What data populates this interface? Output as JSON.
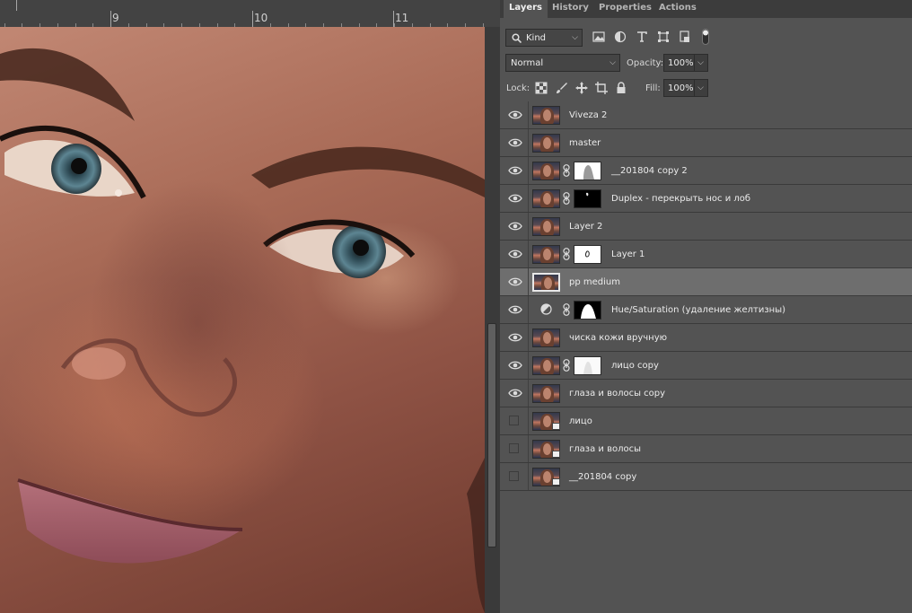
{
  "ruler": {
    "labels": [
      "9",
      "10",
      "11"
    ]
  },
  "panel": {
    "tabs": [
      {
        "label": "Layers",
        "active": true
      },
      {
        "label": "History",
        "active": false
      },
      {
        "label": "Properties",
        "active": false
      },
      {
        "label": "Actions",
        "active": false
      }
    ],
    "filter": {
      "kind_label": "Kind",
      "icons": [
        "pixel-filter-icon",
        "adjustment-filter-icon",
        "type-filter-icon",
        "shape-filter-icon",
        "smart-object-filter-icon",
        "filter-toggle-icon"
      ]
    },
    "blend": {
      "mode": "Normal",
      "opacity_label": "Opacity:",
      "opacity_value": "100%"
    },
    "lock": {
      "label": "Lock:",
      "fill_label": "Fill:",
      "fill_value": "100%",
      "icons": [
        "lock-transparent-icon",
        "lock-paint-icon",
        "lock-move-icon",
        "lock-artboard-icon",
        "lock-all-icon"
      ]
    }
  },
  "layers": [
    {
      "name": "Viveza 2",
      "visible": true,
      "type": "pixel"
    },
    {
      "name": "master",
      "visible": true,
      "type": "pixel"
    },
    {
      "name": "__201804 copy 2",
      "visible": true,
      "type": "masked",
      "mask": "silhouette"
    },
    {
      "name": "Duplex - перекрыть нос и лоб",
      "visible": true,
      "type": "masked",
      "mask": "black-small"
    },
    {
      "name": "Layer 2",
      "visible": true,
      "type": "pixel"
    },
    {
      "name": "Layer 1",
      "visible": true,
      "type": "masked",
      "mask": "white-small"
    },
    {
      "name": "pp medium",
      "visible": true,
      "type": "pixel",
      "selected": true
    },
    {
      "name": "Hue/Saturation  (удаление желтизны)",
      "visible": true,
      "type": "adjustment",
      "mask": "black-silhouette"
    },
    {
      "name": "чиска кожи вручную",
      "visible": true,
      "type": "pixel"
    },
    {
      "name": "лицо  copy",
      "visible": true,
      "type": "masked",
      "mask": "white-faint"
    },
    {
      "name": "глаза и волосы copy",
      "visible": true,
      "type": "pixel"
    },
    {
      "name": "лицо",
      "visible": false,
      "type": "smart"
    },
    {
      "name": "глаза и волосы",
      "visible": false,
      "type": "smart"
    },
    {
      "name": "__201804 copy",
      "visible": false,
      "type": "smart"
    }
  ],
  "colors": {
    "panel_bg": "#535353",
    "tab_bar": "#3c3c3c",
    "selected_row": "#6e6e6e",
    "canvas_bg": "#282828"
  }
}
